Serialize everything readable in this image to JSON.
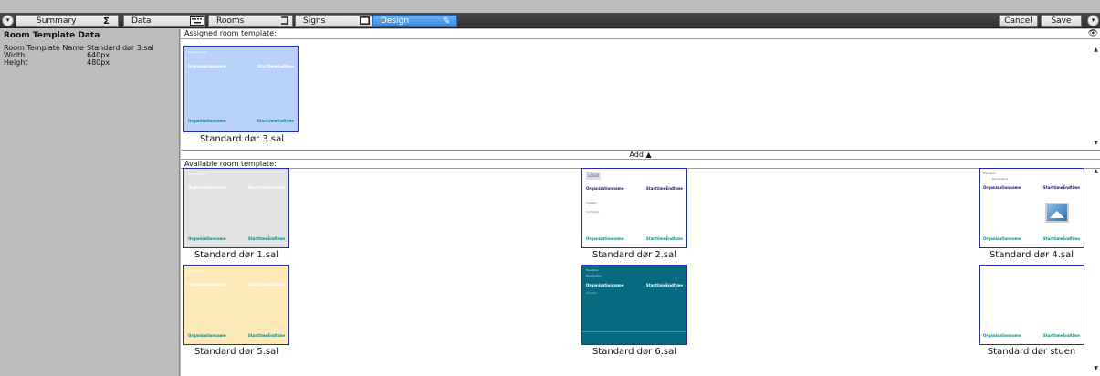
{
  "tabs": {
    "summary": "Summary",
    "summary_icon": "Σ",
    "data": "Data",
    "rooms": "Rooms",
    "signs": "Signs",
    "design": "Design"
  },
  "toolbar": {
    "cancel": "Cancel",
    "save": "Save"
  },
  "left_panel": {
    "title": "Room Template Data",
    "rows": [
      {
        "key": "Room Template Name",
        "value": "Standard dør 3.sal"
      },
      {
        "key": "Width",
        "value": "640px"
      },
      {
        "key": "Height",
        "value": "480px"
      }
    ]
  },
  "assigned": {
    "label": "Assigned room template:",
    "template": {
      "name": "Standard dør 3.sal",
      "org": "Organisationname",
      "time": "StarttimeEndtime",
      "org2": "Organisationname",
      "time2": "StarttimeEndtime"
    }
  },
  "add_label": "Add ▲",
  "available": {
    "label": "Available room template:",
    "templates": [
      {
        "name": "Standard dør 1.sal",
        "org": "Organisationname",
        "time": "StarttimeEndtime",
        "org2": "Organisationname",
        "time2": "StarttimeEndtime"
      },
      {
        "name": "Standard dør 2.sal",
        "logo": "LOGO",
        "org": "Organisationname",
        "time": "StarttimeEndtime",
        "org2": "Organisationname",
        "time2": "StarttimeEndtime"
      },
      {
        "name": "Standard dør 4.sal",
        "org": "Organisationname",
        "time": "StarttimeEndtime",
        "org2": "Organisationname",
        "time2": "StarttimeEndtime"
      },
      {
        "name": "Standard dør 5.sal",
        "org": "Organisationname",
        "time": "StarttimeEndtime",
        "org2": "Organisationname",
        "time2": "StarttimeEndtime"
      },
      {
        "name": "Standard dør 6.sal",
        "org": "Organisationname",
        "time": "StarttimeEndtime"
      },
      {
        "name": "Standard dør stuen",
        "org2": "Organisationname",
        "time2": "StarttimeEndtime"
      }
    ]
  },
  "colors": {
    "blue_bg": "#b9d0f7",
    "gray_bg": "#e2e2e2",
    "yellow_bg": "#fde9b8",
    "teal_bg": "#066a80",
    "text_teal": "#0a8a8a",
    "text_navy": "#16166b",
    "frame": "#2a2ab8"
  }
}
